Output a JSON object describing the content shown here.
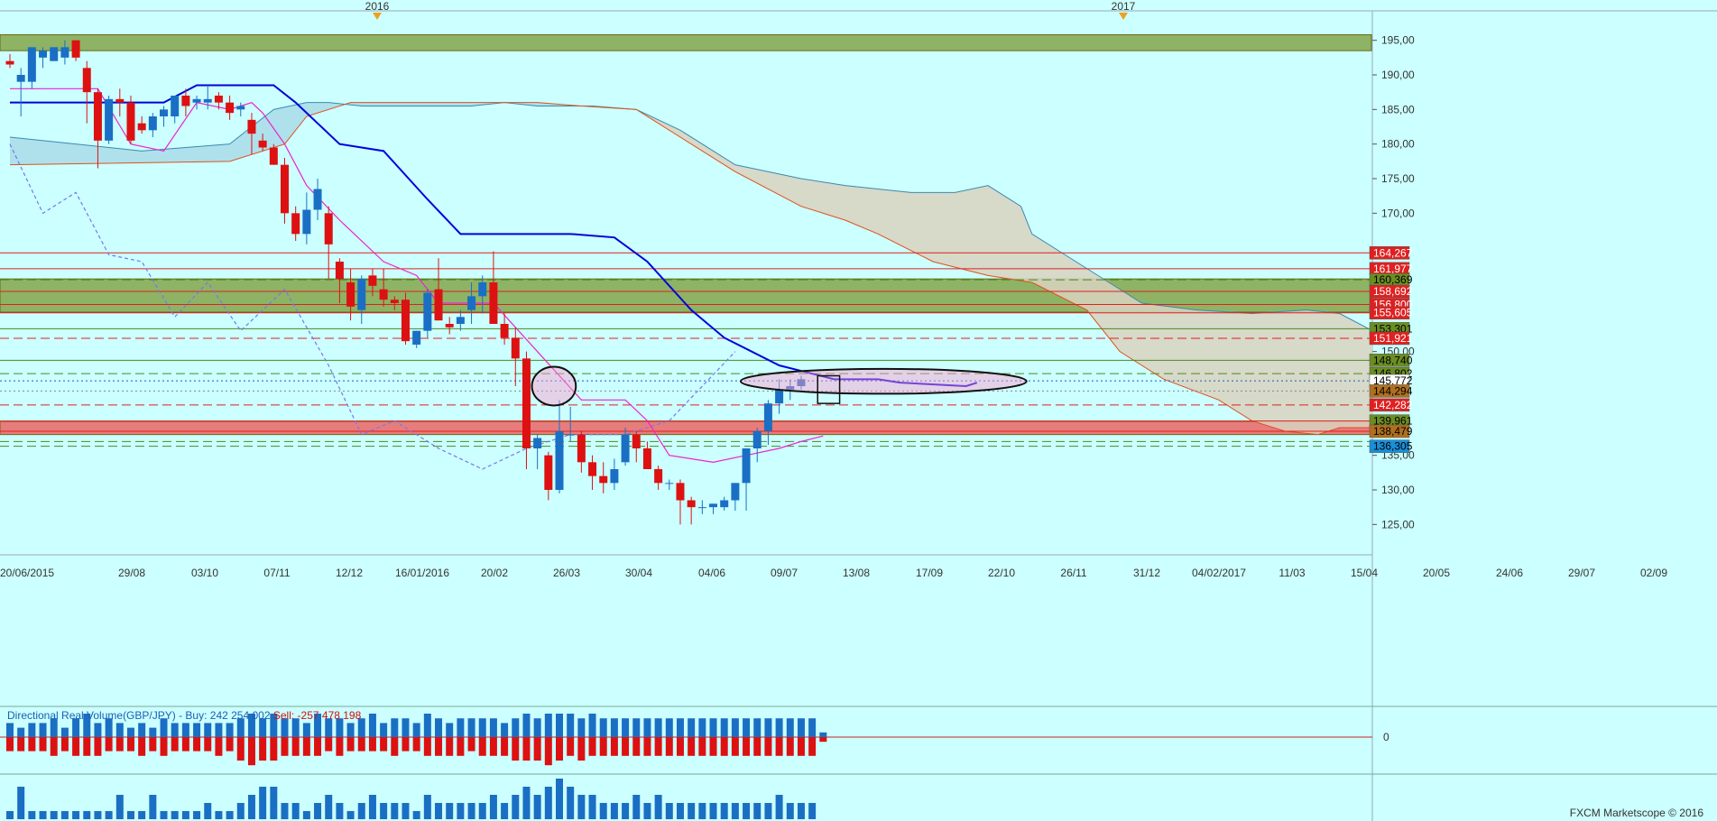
{
  "chart_data": {
    "type": "candlestick",
    "instrument": "GBP/JPY",
    "ylim": [
      121,
      199
    ],
    "y_ticks": [
      195,
      190,
      185,
      180,
      175,
      170,
      165,
      150,
      135,
      130,
      125
    ],
    "y_tick_labels": [
      "195,00",
      "190,00",
      "185,00",
      "180,00",
      "175,00",
      "170,00",
      "",
      "150,00",
      "135,00",
      "130,00",
      "125,00"
    ],
    "year_markers": [
      "2016",
      "2017"
    ],
    "x_labels": [
      "20/06/2015",
      "29/08",
      "03/10",
      "07/11",
      "12/12",
      "16/01/2016",
      "20/02",
      "26/03",
      "30/04",
      "04/06",
      "09/07",
      "13/08",
      "17/09",
      "22/10",
      "26/11",
      "31/12",
      "04/02/2017",
      "11/03",
      "15/04",
      "20/05",
      "24/06",
      "29/07",
      "02/09"
    ],
    "candles": [
      [
        192,
        193,
        191,
        191.5
      ],
      [
        189,
        191,
        184,
        190
      ],
      [
        189,
        194,
        188,
        194
      ],
      [
        192.5,
        194,
        191,
        193.5
      ],
      [
        192,
        194,
        192,
        194
      ],
      [
        192.5,
        195,
        191.5,
        194
      ],
      [
        195,
        195,
        192,
        192.5
      ],
      [
        191,
        192,
        183,
        187.5
      ],
      [
        187.5,
        188,
        176.5,
        180.5
      ],
      [
        180.5,
        187,
        180,
        186.5
      ],
      [
        186.5,
        188,
        184,
        186
      ],
      [
        186,
        187,
        180,
        180.5
      ],
      [
        183,
        184,
        181.5,
        182
      ],
      [
        182,
        184.5,
        181,
        184
      ],
      [
        184,
        185.5,
        182.5,
        185
      ],
      [
        184,
        187,
        183,
        187
      ],
      [
        187,
        188,
        184,
        185.5
      ],
      [
        186,
        187,
        185,
        186.5
      ],
      [
        186,
        188.5,
        185,
        186.5
      ],
      [
        187,
        187.5,
        185,
        186
      ],
      [
        186,
        187,
        183.5,
        184.5
      ],
      [
        185,
        186,
        184,
        185.5
      ],
      [
        183.5,
        184.5,
        178.5,
        181.5
      ],
      [
        180.5,
        181.5,
        179,
        179.5
      ],
      [
        179.5,
        180,
        177,
        177
      ],
      [
        177,
        178,
        168.5,
        170
      ],
      [
        170,
        171,
        166,
        167
      ],
      [
        167,
        173,
        165.5,
        170.5
      ],
      [
        170.5,
        175,
        169,
        173.5
      ],
      [
        170,
        171,
        160.5,
        165.5
      ],
      [
        163,
        163.5,
        157,
        160.5
      ],
      [
        160,
        162,
        154.5,
        156.5
      ],
      [
        156,
        161,
        154,
        160.5
      ],
      [
        161,
        162,
        158,
        159.5
      ],
      [
        159,
        162,
        156.5,
        157.5
      ],
      [
        157.5,
        158,
        156,
        157
      ],
      [
        157.5,
        158.5,
        151,
        151.5
      ],
      [
        151,
        153,
        150.5,
        153
      ],
      [
        153,
        159,
        152,
        158.5
      ],
      [
        159,
        163.5,
        154.5,
        154.5
      ],
      [
        154,
        155,
        152.5,
        153.5
      ],
      [
        154,
        156,
        153,
        155
      ],
      [
        156,
        160,
        154,
        158
      ],
      [
        158,
        161,
        155.5,
        160
      ],
      [
        160,
        164.5,
        154,
        154
      ],
      [
        154,
        155.5,
        151,
        152
      ],
      [
        152,
        153.5,
        145,
        149
      ],
      [
        149,
        150,
        133,
        136
      ],
      [
        136,
        138,
        133,
        137.5
      ],
      [
        135,
        135.5,
        128.5,
        130
      ],
      [
        130,
        143,
        129.5,
        138.5
      ],
      [
        138,
        142,
        137,
        138
      ],
      [
        138,
        138.5,
        132.5,
        134
      ],
      [
        134,
        135,
        130,
        132
      ],
      [
        132,
        134,
        129.5,
        131
      ],
      [
        131,
        134.5,
        130,
        133
      ],
      [
        134,
        139,
        133.5,
        138
      ],
      [
        138,
        138.5,
        134,
        136
      ],
      [
        136,
        137,
        133,
        133
      ],
      [
        133,
        133.5,
        130,
        131
      ],
      [
        131,
        131.5,
        130,
        131
      ],
      [
        131,
        131.5,
        125,
        128.5
      ],
      [
        128.5,
        129,
        125,
        127.5
      ],
      [
        127.5,
        128.5,
        126.5,
        127.5
      ],
      [
        127.5,
        128,
        126.5,
        128
      ],
      [
        127.5,
        129,
        127,
        128.5
      ],
      [
        128.5,
        131,
        127,
        131
      ],
      [
        131,
        136,
        127,
        136
      ],
      [
        136,
        139,
        134,
        138.5
      ],
      [
        138.5,
        143,
        136.5,
        142.5
      ],
      [
        142.5,
        146,
        141,
        144.5
      ],
      [
        144.5,
        146,
        143,
        145
      ],
      [
        145,
        146.5,
        144.5,
        146
      ]
    ],
    "hlines": [
      {
        "price": 164.267,
        "label": "164,267",
        "color": "#e02020",
        "style": "solid"
      },
      {
        "price": 161.977,
        "label": "161,977",
        "color": "#e02020",
        "style": "solid"
      },
      {
        "price": 160.369,
        "label": "160,369",
        "color": "#4a8a20",
        "style": "dashed"
      },
      {
        "price": 158.692,
        "label": "158,692",
        "color": "#e02020",
        "style": "solid"
      },
      {
        "price": 156.8,
        "label": "156,800",
        "color": "#e02020",
        "style": "solid"
      },
      {
        "price": 155.605,
        "label": "155,605",
        "color": "#e02020",
        "style": "solid"
      },
      {
        "price": 153.301,
        "label": "153,301",
        "color": "#4a8a20",
        "style": "solid"
      },
      {
        "price": 151.921,
        "label": "151,921",
        "color": "#e02020",
        "style": "dashed"
      },
      {
        "price": 148.74,
        "label": "148,740",
        "color": "#4a8a20",
        "style": "solid"
      },
      {
        "price": 146.802,
        "label": "146,802",
        "color": "#4a8a20",
        "style": "dashed"
      },
      {
        "price": 145.772,
        "label": "145,772",
        "color": "#1a5fb4",
        "style": "dotted"
      },
      {
        "price": 144.294,
        "label": "144,294",
        "color": "#888888",
        "style": "dotted"
      },
      {
        "price": 142.282,
        "label": "142,282",
        "color": "#e02020",
        "style": "dashed"
      },
      {
        "price": 139.961,
        "label": "139,961",
        "color": "#e02020",
        "style": "solid"
      },
      {
        "price": 138.479,
        "label": "138,479",
        "color": "#e02020",
        "style": "solid"
      },
      {
        "price": 137.0,
        "label": "",
        "color": "#4a8a20",
        "style": "dashed"
      },
      {
        "price": 136.305,
        "label": "136,305",
        "color": "#4a8a20",
        "style": "dashed"
      }
    ],
    "price_tags": [
      {
        "label": "164,267",
        "bg": "#e02020",
        "fg": "#ffffff"
      },
      {
        "label": "161,977",
        "bg": "#e02020",
        "fg": "#ffffff"
      },
      {
        "label": "160,369",
        "bg": "#6b8e23",
        "fg": "#000000"
      },
      {
        "label": "158,692",
        "bg": "#e02020",
        "fg": "#ffffff"
      },
      {
        "label": "156,800",
        "bg": "#e02020",
        "fg": "#ffffff"
      },
      {
        "label": "155,605",
        "bg": "#e02020",
        "fg": "#ffffff"
      },
      {
        "label": "153,301",
        "bg": "#6b8e23",
        "fg": "#000000"
      },
      {
        "label": "151,921",
        "bg": "#e02020",
        "fg": "#ffffff"
      },
      {
        "label": "148,740",
        "bg": "#6b8e23",
        "fg": "#000000"
      },
      {
        "label": "146,802",
        "bg": "#6b8e23",
        "fg": "#000000"
      },
      {
        "label": "145,772",
        "bg": "#ffffff",
        "fg": "#000000"
      },
      {
        "label": "144,294",
        "bg": "#b07020",
        "fg": "#000000"
      },
      {
        "label": "142,282",
        "bg": "#e02020",
        "fg": "#ffffff"
      },
      {
        "label": "139,961",
        "bg": "#6b8e23",
        "fg": "#000000"
      },
      {
        "label": "138,479",
        "bg": "#b07020",
        "fg": "#000000"
      },
      {
        "label": "136,305",
        "bg": "#1a8fd8",
        "fg": "#000000"
      }
    ],
    "zones": [
      {
        "from": 193.5,
        "to": 195.8,
        "color": "#7a9a30"
      },
      {
        "from": 155.7,
        "to": 160.5,
        "color": "#7a9a30"
      },
      {
        "from": 138.0,
        "to": 139.9,
        "color": "#f05050"
      }
    ],
    "tenkan": [
      [
        0,
        188
      ],
      [
        8,
        188
      ],
      [
        11,
        180
      ],
      [
        14,
        179
      ],
      [
        17,
        186
      ],
      [
        20,
        185
      ],
      [
        22,
        186
      ],
      [
        23,
        184.5
      ],
      [
        25,
        180
      ],
      [
        27,
        174
      ],
      [
        30,
        169
      ],
      [
        34,
        163
      ],
      [
        37,
        161
      ],
      [
        39,
        157
      ],
      [
        44,
        157
      ],
      [
        48,
        150
      ],
      [
        52,
        143
      ],
      [
        56,
        143
      ],
      [
        58,
        140
      ],
      [
        60,
        135
      ],
      [
        64,
        134
      ],
      [
        67,
        135
      ],
      [
        70,
        136
      ],
      [
        72,
        137
      ],
      [
        74,
        137.8
      ]
    ],
    "kijun": [
      [
        0,
        186
      ],
      [
        14,
        186
      ],
      [
        17,
        188.5
      ],
      [
        24,
        188.5
      ],
      [
        26,
        186
      ],
      [
        30,
        180
      ],
      [
        34,
        179
      ],
      [
        38,
        172
      ],
      [
        41,
        167
      ],
      [
        51,
        167
      ],
      [
        55,
        166.5
      ],
      [
        58,
        163
      ],
      [
        62,
        156
      ],
      [
        65,
        152
      ],
      [
        70,
        148
      ],
      [
        75,
        146
      ],
      [
        79,
        146
      ],
      [
        81,
        145.5
      ],
      [
        87,
        145
      ],
      [
        88,
        145.5
      ]
    ],
    "chikou": [
      [
        0,
        180
      ],
      [
        3,
        170
      ],
      [
        6,
        173
      ],
      [
        9,
        164
      ],
      [
        12,
        163
      ],
      [
        15,
        155
      ],
      [
        18,
        160
      ],
      [
        21,
        153
      ],
      [
        25,
        159
      ],
      [
        29,
        148
      ],
      [
        32,
        138
      ],
      [
        35,
        140
      ],
      [
        39,
        136
      ],
      [
        43,
        133
      ],
      [
        47,
        136
      ],
      [
        51,
        138
      ],
      [
        56,
        138
      ],
      [
        60,
        140
      ],
      [
        63,
        145
      ],
      [
        66,
        150
      ]
    ],
    "cloud_upper": [
      [
        0,
        181
      ],
      [
        12,
        179
      ],
      [
        20,
        180
      ],
      [
        24,
        185
      ],
      [
        27,
        186
      ],
      [
        29,
        186
      ],
      [
        32,
        185.5
      ],
      [
        42,
        185.5
      ],
      [
        45,
        186
      ],
      [
        48,
        185.5
      ],
      [
        53,
        185.5
      ],
      [
        57,
        185
      ],
      [
        61,
        182
      ],
      [
        66,
        177
      ],
      [
        72,
        175
      ],
      [
        76,
        174
      ],
      [
        82,
        173
      ],
      [
        86,
        173
      ],
      [
        89,
        174
      ],
      [
        92,
        171
      ],
      [
        93,
        167
      ],
      [
        97,
        163
      ],
      [
        100,
        160
      ],
      [
        103,
        157
      ],
      [
        108,
        156
      ],
      [
        113,
        155.5
      ],
      [
        118,
        156
      ],
      [
        121,
        155.5
      ],
      [
        124,
        153
      ]
    ],
    "cloud_lower": [
      [
        0,
        177
      ],
      [
        20,
        177.5
      ],
      [
        25,
        180
      ],
      [
        27,
        184
      ],
      [
        31,
        186
      ],
      [
        42,
        186
      ],
      [
        48,
        186
      ],
      [
        52,
        185.5
      ],
      [
        57,
        185
      ],
      [
        61,
        181
      ],
      [
        66,
        176
      ],
      [
        72,
        171
      ],
      [
        76,
        169
      ],
      [
        79,
        167
      ],
      [
        84,
        163
      ],
      [
        89,
        161
      ],
      [
        93,
        160
      ],
      [
        98,
        156
      ],
      [
        101,
        150
      ],
      [
        105,
        146
      ],
      [
        110,
        143
      ],
      [
        113,
        140
      ],
      [
        116,
        138.5
      ],
      [
        119,
        138
      ],
      [
        121,
        139
      ],
      [
        124,
        139
      ]
    ],
    "ellipses": [
      {
        "cx_bar": 49.5,
        "cy": 145,
        "rx_bars": 2.0,
        "ry": 2.8
      },
      {
        "cx_bar": 79.5,
        "cy": 145.7,
        "rx_bars": 13.0,
        "ry": 1.8
      }
    ],
    "box": {
      "from_bar": 73.5,
      "to_bar": 75.5,
      "lo": 142.5,
      "hi": 146.5
    },
    "volume": {
      "label": "Directional Real Volume(GBP/JPY) -",
      "buy_label": "Buy:",
      "buy_value": "242 254 002",
      "sell_label": "Sell:",
      "sell_value": "-257 478 198",
      "zero_label": "0",
      "buy": [
        3,
        2,
        3,
        3,
        4,
        2,
        4,
        5,
        3,
        4,
        3,
        2,
        3,
        2,
        4,
        3,
        3,
        3,
        3,
        3,
        3,
        4,
        5,
        4,
        5,
        4,
        4,
        3,
        5,
        4,
        4,
        3,
        4,
        5,
        3,
        4,
        4,
        3,
        5,
        4,
        3,
        4,
        4,
        4,
        4,
        3,
        4,
        5,
        4,
        5,
        5,
        5,
        4,
        5,
        4,
        4,
        4,
        4,
        4,
        4,
        4,
        4,
        4,
        4,
        4,
        4,
        4,
        4,
        4,
        4,
        4,
        4,
        4,
        4,
        1
      ],
      "sell": [
        3,
        3,
        3,
        3,
        4,
        3,
        4,
        4,
        4,
        3,
        3,
        3,
        4,
        3,
        4,
        3,
        3,
        3,
        3,
        4,
        3,
        5,
        6,
        5,
        5,
        4,
        4,
        4,
        4,
        3,
        4,
        3,
        3,
        3,
        3,
        4,
        3,
        3,
        4,
        4,
        4,
        4,
        3,
        4,
        4,
        4,
        5,
        5,
        5,
        6,
        5,
        4,
        5,
        4,
        4,
        4,
        4,
        4,
        4,
        4,
        4,
        4,
        4,
        4,
        4,
        4,
        4,
        4,
        4,
        4,
        4,
        4,
        4,
        4,
        1
      ],
      "lower": [
        1,
        4,
        1,
        1,
        1,
        1,
        1,
        1,
        1,
        1,
        3,
        1,
        1,
        3,
        1,
        1,
        1,
        1,
        2,
        1,
        1,
        2,
        3,
        4,
        4,
        2,
        2,
        1,
        2,
        3,
        2,
        1,
        2,
        3,
        2,
        2,
        2,
        1,
        3,
        2,
        2,
        2,
        2,
        2,
        3,
        2,
        3,
        4,
        3,
        4,
        5,
        4,
        3,
        3,
        2,
        2,
        2,
        3,
        2,
        3,
        2,
        2,
        2,
        2,
        2,
        2,
        2,
        2,
        2,
        2,
        3,
        2,
        2,
        2,
        0
      ]
    },
    "footer": "FXCM Marketscope © 2016",
    "colors": {
      "up": "#1a6fc4",
      "down": "#dd1111",
      "kijun": "#0000dd",
      "tenkan": "#ee22cc",
      "chikou": "#7777ee",
      "cloud_bull": "#a8dce8",
      "cloud_bear": "#d8d2c0"
    }
  }
}
